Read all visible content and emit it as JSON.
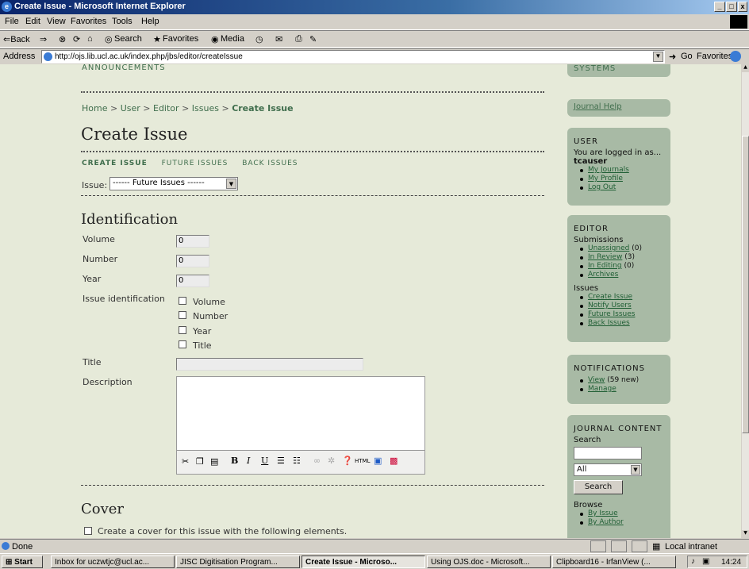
{
  "window": {
    "title": "Create Issue - Microsoft Internet Explorer",
    "min": "_",
    "max": "□",
    "close": "x"
  },
  "menu": [
    "File",
    "Edit",
    "View",
    "Favorites",
    "Tools",
    "Help"
  ],
  "toolbar": {
    "back": "⇐Back",
    "forward": "⇒",
    "stop": "⊗",
    "refresh": "⟳",
    "home": "⌂",
    "search": "Search",
    "favorites": "Favorites",
    "media": "Media"
  },
  "address": {
    "label": "Address",
    "url": "http://ojs.lib.ucl.ac.uk/index.php/jbs/editor/createIssue",
    "go": "Go",
    "favorites": "Favorites"
  },
  "page": {
    "announcements": "ANNOUNCEMENTS",
    "breadcrumb": {
      "home": "Home",
      "user": "User",
      "editor": "Editor",
      "issues": "Issues",
      "current": "Create Issue",
      "sep": ">"
    },
    "title": "Create Issue",
    "tabs": [
      "CREATE ISSUE",
      "FUTURE ISSUES",
      "BACK ISSUES"
    ],
    "issue_label": "Issue:",
    "issue_select": "------ Future Issues ------",
    "identification": "Identification",
    "volume_label": "Volume",
    "volume": "0",
    "number_label": "Number",
    "number": "0",
    "year_label": "Year",
    "year": "0",
    "issue_id_label": "Issue identification",
    "checks": [
      "Volume",
      "Number",
      "Year",
      "Title"
    ],
    "title_label": "Title",
    "description_label": "Description",
    "cover": "Cover",
    "cover_check": "Create a cover for this issue with the following elements."
  },
  "sidebar": {
    "systems": "SYSTEMS",
    "journal_help": "Journal Help",
    "user": {
      "heading": "USER",
      "logged": "You are logged in as...",
      "username": "tcauser",
      "links": [
        "My Journals",
        "My Profile",
        "Log Out"
      ]
    },
    "editor": {
      "heading": "EDITOR",
      "submissions": "Submissions",
      "sub_links": [
        {
          "label": "Unassigned",
          "count": "(0)"
        },
        {
          "label": "In Review",
          "count": "(3)"
        },
        {
          "label": "In Editing",
          "count": "(0)"
        },
        {
          "label": "Archives",
          "count": ""
        }
      ],
      "issues": "Issues",
      "issue_links": [
        "Create Issue",
        "Notify Users",
        "Future Issues",
        "Back Issues"
      ]
    },
    "notifications": {
      "heading": "NOTIFICATIONS",
      "view": "View",
      "view_count": "(59 new)",
      "manage": "Manage"
    },
    "content": {
      "heading": "JOURNAL CONTENT",
      "search": "Search",
      "scope": "All",
      "button": "Search",
      "browse": "Browse",
      "browse_links": [
        "By Issue",
        "By Author"
      ]
    }
  },
  "status": {
    "done": "Done",
    "zone": "Local intranet"
  },
  "taskbar": {
    "start": "Start",
    "tasks": [
      "Inbox for uczwtjc@ucl.ac...",
      "JISC Digitisation Program...",
      "Create Issue - Microso...",
      "Using OJS.doc - Microsoft...",
      "Clipboard16 - IrfanView (..."
    ],
    "clock": "14:24"
  }
}
